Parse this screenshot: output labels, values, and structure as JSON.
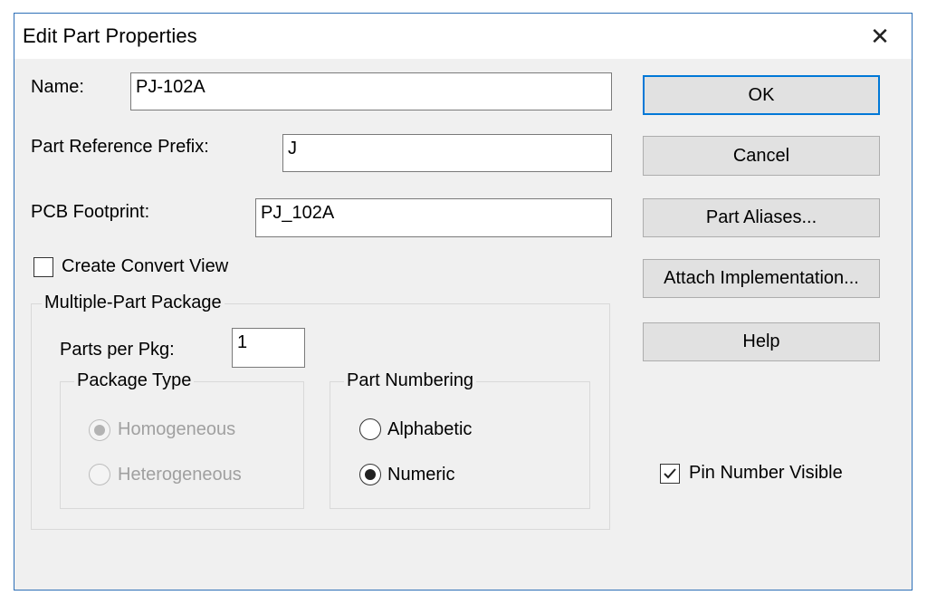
{
  "window": {
    "title": "Edit Part Properties",
    "close_glyph": "✕"
  },
  "fields": {
    "name_label": "Name:",
    "name_value": "PJ-102A",
    "prefix_label": "Part Reference Prefix:",
    "prefix_value": "J",
    "footprint_label": "PCB Footprint:",
    "footprint_value": "PJ_102A"
  },
  "create_convert_view": {
    "label": "Create Convert View",
    "checked": false
  },
  "multiple_part_package": {
    "title": "Multiple-Part Package",
    "parts_per_pkg_label": "Parts per Pkg:",
    "parts_per_pkg_value": "1",
    "package_type": {
      "title": "Package Type",
      "options": [
        {
          "label": "Homogeneous",
          "selected": true,
          "enabled": false
        },
        {
          "label": "Heterogeneous",
          "selected": false,
          "enabled": false
        }
      ]
    },
    "part_numbering": {
      "title": "Part Numbering",
      "options": [
        {
          "label": "Alphabetic",
          "selected": false,
          "enabled": true
        },
        {
          "label": "Numeric",
          "selected": true,
          "enabled": true
        }
      ]
    }
  },
  "buttons": {
    "ok": "OK",
    "cancel": "Cancel",
    "part_aliases": "Part Aliases...",
    "attach_implementation": "Attach Implementation...",
    "help": "Help"
  },
  "pin_number_visible": {
    "label": "Pin Number Visible",
    "checked": true
  },
  "colors": {
    "window_border": "#2d6fb7",
    "dialog_background": "#f0f0f0",
    "default_button_border": "#0078d7",
    "disabled_text": "#a0a0a0"
  }
}
